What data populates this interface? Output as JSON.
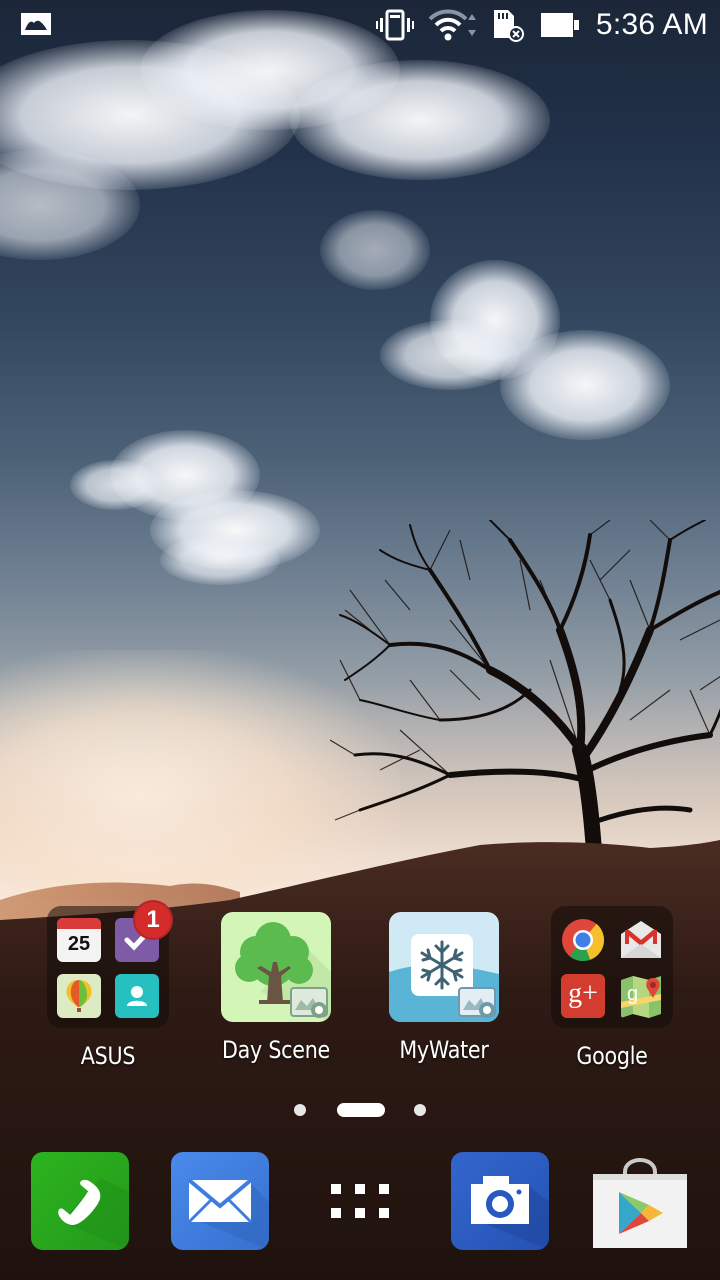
{
  "status_bar": {
    "left_icons": [
      "gallery-notification-icon"
    ],
    "right_icons": [
      "vibrate-icon",
      "wifi-icon",
      "sd-card-removed-icon",
      "battery-icon"
    ],
    "time": "5:36 AM"
  },
  "home": {
    "apps": [
      {
        "label": "ASUS",
        "type": "folder",
        "contents": [
          "calendar-icon",
          "do-it-later-icon",
          "zenui-balloon-icon",
          "contacts-icon"
        ],
        "badge": "1",
        "calendar_date": "25"
      },
      {
        "label": "Day Scene",
        "type": "app",
        "icon": "day-scene-tree-icon"
      },
      {
        "label": "MyWater",
        "type": "app",
        "icon": "mywater-snowflake-icon"
      },
      {
        "label": "Google",
        "type": "folder",
        "contents": [
          "chrome-icon",
          "gmail-icon",
          "google-plus-icon",
          "maps-icon"
        ]
      }
    ],
    "google_plus_text": "g+"
  },
  "pager": {
    "pages": 3,
    "current_page": 2
  },
  "dock": {
    "items": [
      {
        "name": "Phone",
        "icon": "phone-icon",
        "color": "#27a81b"
      },
      {
        "name": "Email",
        "icon": "email-icon",
        "color": "#3d7de0"
      },
      {
        "name": "All Apps",
        "icon": "app-drawer-icon"
      },
      {
        "name": "Camera",
        "icon": "camera-icon",
        "color": "#2858c2"
      },
      {
        "name": "Play Store",
        "icon": "play-store-icon"
      }
    ]
  },
  "colors": {
    "badge": "#d42b2b",
    "status_text": "#ffffff"
  }
}
